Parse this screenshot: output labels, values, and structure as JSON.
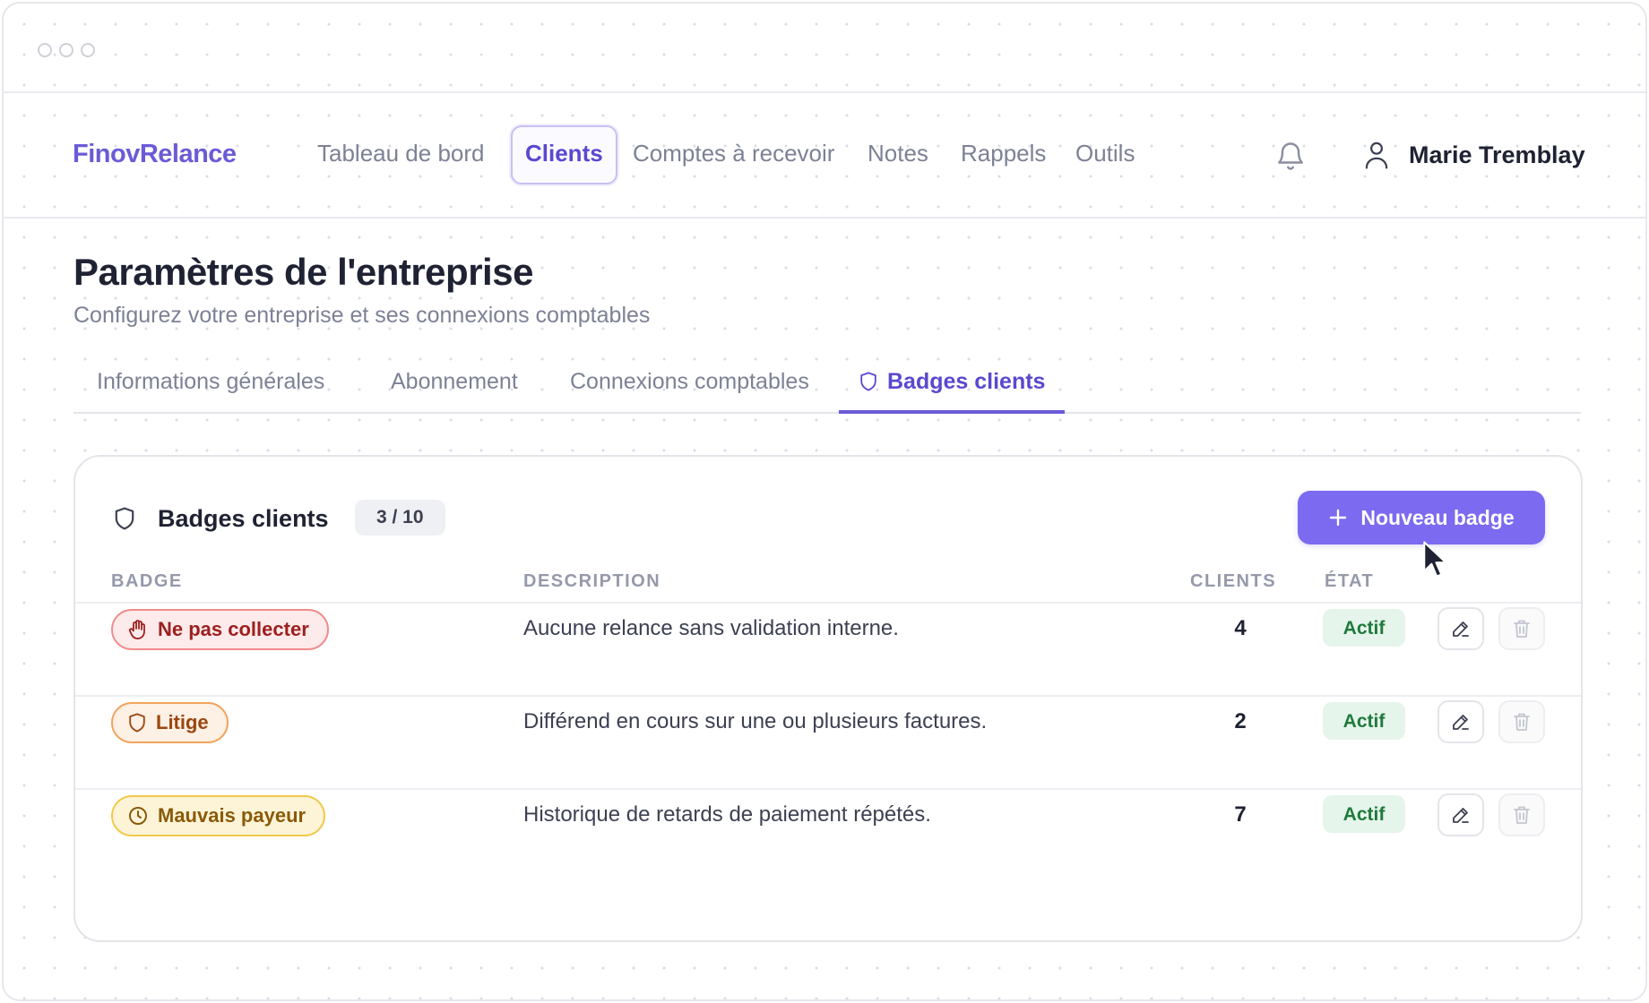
{
  "app": {
    "logo": "FinovRelance"
  },
  "nav": {
    "items": [
      {
        "label": "Tableau de bord",
        "active": false
      },
      {
        "label": "Clients",
        "active": true
      },
      {
        "label": "Comptes à recevoir",
        "active": false
      },
      {
        "label": "Notes",
        "active": false
      },
      {
        "label": "Rappels",
        "active": false
      },
      {
        "label": "Outils",
        "active": false
      }
    ],
    "user_name": "Marie Tremblay"
  },
  "page": {
    "title": "Paramètres de l'entreprise",
    "subtitle": "Configurez votre entreprise et ses connexions comptables"
  },
  "tabs": [
    {
      "label": "Informations générales",
      "active": false
    },
    {
      "label": "Abonnement",
      "active": false
    },
    {
      "label": "Connexions comptables",
      "active": false
    },
    {
      "label": "Badges clients",
      "active": true,
      "icon": "shield-icon"
    }
  ],
  "card": {
    "title": "Badges clients",
    "count": "3 / 10",
    "new_button_label": "Nouveau badge",
    "columns": {
      "badge": "BADGE",
      "description": "DESCRIPTION",
      "clients": "CLIENTS",
      "status": "ÉTAT"
    },
    "rows": [
      {
        "badge": "Ne pas collecter",
        "icon": "hand-stop-icon",
        "color": "#f08c8c",
        "description": "Aucune relance sans validation interne.",
        "clients": "4",
        "status": "Actif"
      },
      {
        "badge": "Litige",
        "icon": "shield-icon",
        "color": "#f1a45c",
        "description": "Différend en cours sur une ou plusieurs factures.",
        "clients": "2",
        "status": "Actif"
      },
      {
        "badge": "Mauvais payeur",
        "icon": "clock-icon",
        "color": "#f0c94a",
        "description": "Historique de retards de paiement répétés.",
        "clients": "7",
        "status": "Actif"
      }
    ]
  },
  "colors": {
    "accent": "#7c6af0",
    "status_active_bg": "#e6f5eb",
    "status_active_text": "#1f7a3c"
  }
}
